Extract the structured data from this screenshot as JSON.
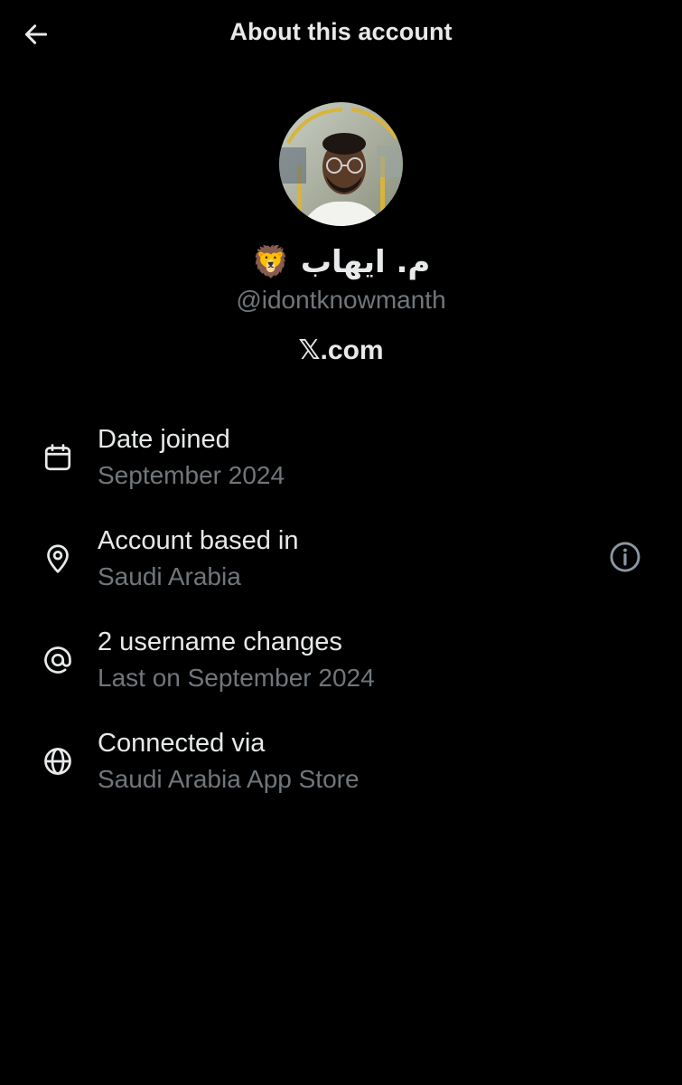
{
  "header": {
    "title": "About this account",
    "back_icon": "arrow-left-icon"
  },
  "profile": {
    "display_name": "م. ايهاب",
    "display_name_emoji": "🦁",
    "handle": "@idontknowmanth",
    "domain": "𝕏.com"
  },
  "details": [
    {
      "icon": "calendar-icon",
      "title": "Date joined",
      "subtitle": "September 2024"
    },
    {
      "icon": "location-pin-icon",
      "title": "Account based in",
      "subtitle": "Saudi Arabia",
      "action_icon": "info-icon"
    },
    {
      "icon": "at-sign-icon",
      "title": "2 username changes",
      "subtitle": "Last on September 2024"
    },
    {
      "icon": "globe-icon",
      "title": "Connected via",
      "subtitle": "Saudi Arabia App Store"
    }
  ],
  "colors": {
    "background": "#000000",
    "primary_text": "#e7e9ea",
    "secondary_text": "#71767b"
  }
}
